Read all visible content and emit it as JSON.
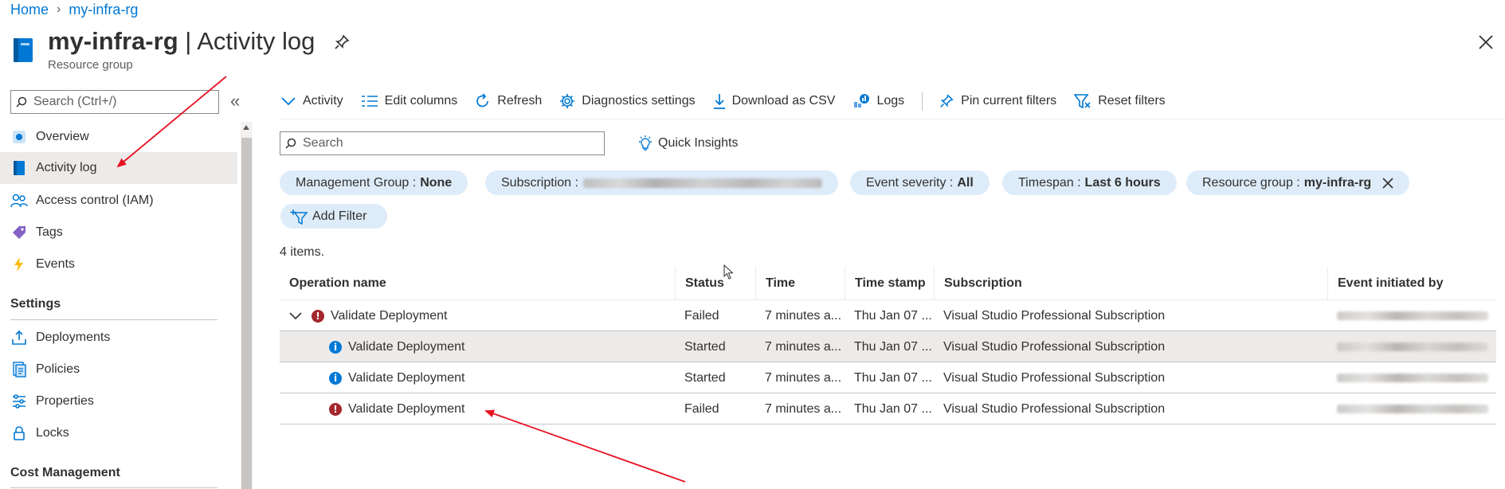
{
  "breadcrumb": {
    "home": "Home",
    "current": "my-infra-rg"
  },
  "header": {
    "title_main": "my-infra-rg",
    "title_sep": " | ",
    "title_page": "Activity log",
    "subtitle": "Resource group"
  },
  "sidebar": {
    "search_placeholder": "Search (Ctrl+/)",
    "items": [
      {
        "label": "Overview",
        "icon": "overview-icon"
      },
      {
        "label": "Activity log",
        "icon": "activity-log-icon",
        "active": true
      },
      {
        "label": "Access control (IAM)",
        "icon": "iam-icon"
      },
      {
        "label": "Tags",
        "icon": "tag-icon"
      },
      {
        "label": "Events",
        "icon": "lightning-icon"
      }
    ],
    "settings_title": "Settings",
    "settings_items": [
      {
        "label": "Deployments",
        "icon": "deployments-icon"
      },
      {
        "label": "Policies",
        "icon": "policies-icon"
      },
      {
        "label": "Properties",
        "icon": "properties-icon"
      },
      {
        "label": "Locks",
        "icon": "lock-icon"
      }
    ],
    "cost_title": "Cost Management"
  },
  "toolbar": {
    "activity": "Activity",
    "edit_columns": "Edit columns",
    "refresh": "Refresh",
    "diagnostics": "Diagnostics settings",
    "download": "Download as CSV",
    "logs": "Logs",
    "pin_filters": "Pin current filters",
    "reset_filters": "Reset filters"
  },
  "search": {
    "placeholder": "Search"
  },
  "quick_insights": "Quick Insights",
  "filters": {
    "management_group": {
      "label": "Management Group : ",
      "value": "None"
    },
    "subscription": {
      "label": "Subscription : "
    },
    "event_severity": {
      "label": "Event severity : ",
      "value": "All"
    },
    "timespan": {
      "label": "Timespan : ",
      "value": "Last 6 hours"
    },
    "resource_group": {
      "label": "Resource group : ",
      "value": "my-infra-rg"
    },
    "add_filter": "Add Filter"
  },
  "item_count": "4 items.",
  "table": {
    "columns": [
      "Operation name",
      "Status",
      "Time",
      "Time stamp",
      "Subscription",
      "Event initiated by"
    ],
    "rows": [
      {
        "operation": "Validate Deployment",
        "status": "Failed",
        "time": "7 minutes a...",
        "timestamp": "Thu Jan 07 ...",
        "subscription": "Visual Studio Professional Subscription",
        "level": "error",
        "expandable": true
      },
      {
        "operation": "Validate Deployment",
        "status": "Started",
        "time": "7 minutes a...",
        "timestamp": "Thu Jan 07 ...",
        "subscription": "Visual Studio Professional Subscription",
        "level": "info",
        "selected": true
      },
      {
        "operation": "Validate Deployment",
        "status": "Started",
        "time": "7 minutes a...",
        "timestamp": "Thu Jan 07 ...",
        "subscription": "Visual Studio Professional Subscription",
        "level": "info"
      },
      {
        "operation": "Validate Deployment",
        "status": "Failed",
        "time": "7 minutes a...",
        "timestamp": "Thu Jan 07 ...",
        "subscription": "Visual Studio Professional Subscription",
        "level": "error"
      }
    ]
  },
  "colors": {
    "accent": "#0078d4",
    "error": "#a4262c",
    "annotation_arrow": "#e81123",
    "pill_bg": "#deecf9"
  }
}
